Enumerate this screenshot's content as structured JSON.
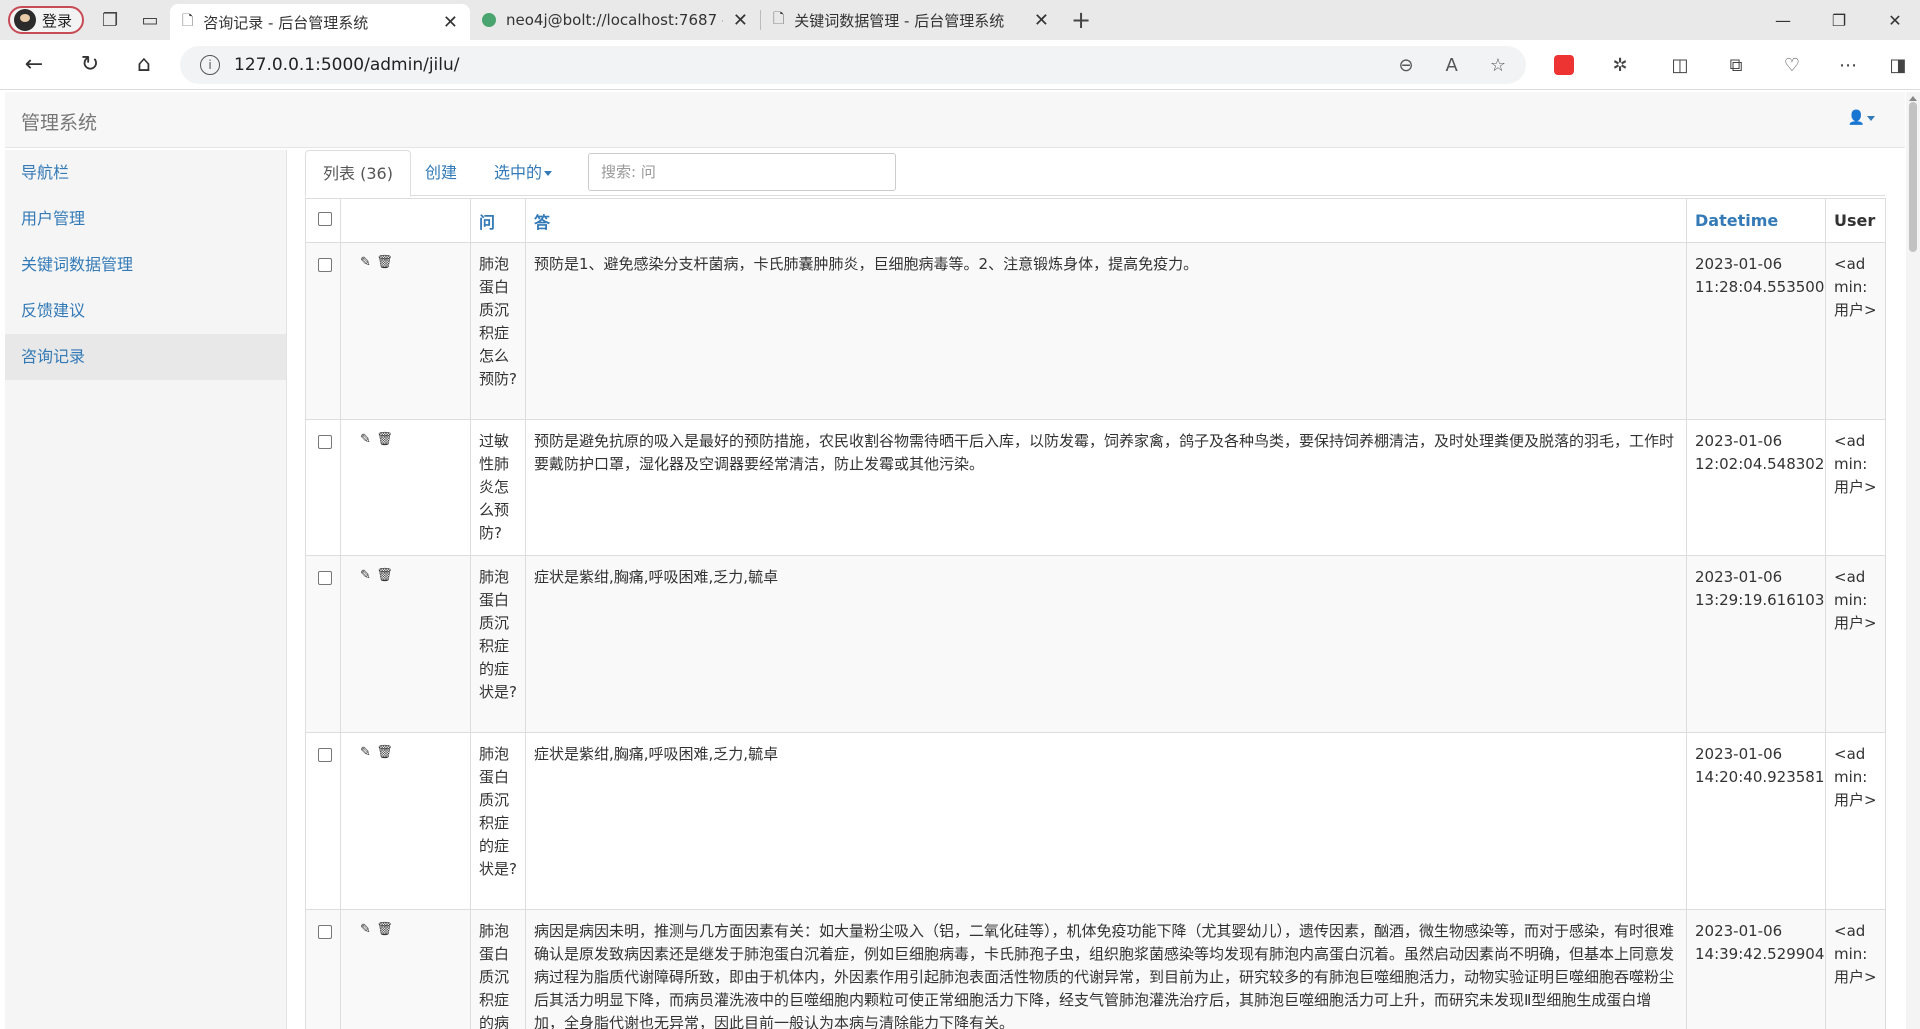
{
  "browser": {
    "profile_label": "登录",
    "tabs": [
      {
        "title": "咨询记录 - 后台管理系统",
        "active": true
      },
      {
        "title": "neo4j@bolt://localhost:7687 - Ne",
        "active": false
      },
      {
        "title": "关键词数据管理 - 后台管理系统",
        "active": false
      }
    ],
    "url": "127.0.0.1:5000/admin/jilu/"
  },
  "admin": {
    "brand": "管理系统",
    "sidebar": [
      {
        "label": "导航栏",
        "active": false
      },
      {
        "label": "用户管理",
        "active": false
      },
      {
        "label": "关键词数据管理",
        "active": false
      },
      {
        "label": "反馈建议",
        "active": false
      },
      {
        "label": "咨询记录",
        "active": true
      }
    ],
    "toolbar": {
      "list_label": "列表 (36)",
      "create_label": "创建",
      "selected_label": "选中的",
      "search_placeholder": "搜索: 问"
    },
    "columns": [
      "问",
      "答",
      "Datetime",
      "User"
    ],
    "rows": [
      {
        "q": "肺泡蛋白质沉积症怎么预防?",
        "a": "预防是1、避免感染分支杆菌病，卡氏肺囊肿肺炎，巨细胞病毒等。2、注意锻炼身体，提高免疫力。",
        "datetime": "2023-01-06 11:28:04.553500",
        "user": "<admin: 用户>"
      },
      {
        "q": "过敏性肺炎怎么预防?",
        "a": "预防是避免抗原的吸入是最好的预防措施，农民收割谷物需待晒干后入库，以防发霉，饲养家禽，鸽子及各种鸟类，要保持饲养棚清洁，及时处理粪便及脱落的羽毛，工作时要戴防护口罩，湿化器及空调器要经常清洁，防止发霉或其他污染。",
        "datetime": "2023-01-06 12:02:04.548302",
        "user": "<admin: 用户>"
      },
      {
        "q": "肺泡蛋白质沉积症的症状是?",
        "a": "症状是紫绀,胸痛,呼吸困难,乏力,毓卓",
        "datetime": "2023-01-06 13:29:19.616103",
        "user": "<admin: 用户>"
      },
      {
        "q": "肺泡蛋白质沉积症的症状是?",
        "a": "症状是紫绀,胸痛,呼吸困难,乏力,毓卓",
        "datetime": "2023-01-06 14:20:40.923581",
        "user": "<admin: 用户>"
      },
      {
        "q": "肺泡蛋白质沉积症的病",
        "a": "病因是病因未明，推测与几方面因素有关：如大量粉尘吸入（铝，二氧化硅等），机体免疫功能下降（尤其婴幼儿），遗传因素，酗酒，微生物感染等，而对于感染，有时很难确认是原发致病因素还是继发于肺泡蛋白沉着症，例如巨细胞病毒，卡氏肺孢子虫，组织胞浆菌感染等均发现有肺泡内高蛋白沉着。虽然启动因素尚不明确，但基本上同意发病过程为脂质代谢障碍所致，即由于机体内，外因素作用引起肺泡表面活性物质的代谢异常，到目前为止，研究较多的有肺泡巨噬细胞活力，动物实验证明巨噬细胞吞噬粉尘后其活力明显下降，而病员灌洗液中的巨噬细胞内颗粒可使正常细胞活力下降，经支气管肺泡灌洗治疗后，其肺泡巨噬细胞活力可上升，而研究未发现Ⅱ型细胞生成蛋白增加，全身脂代谢也无异常，因此目前一般认为本病与清除能力下降有关。",
        "datetime": "2023-01-06 14:39:42.529904",
        "user": "<admin: 用户>"
      }
    ]
  }
}
